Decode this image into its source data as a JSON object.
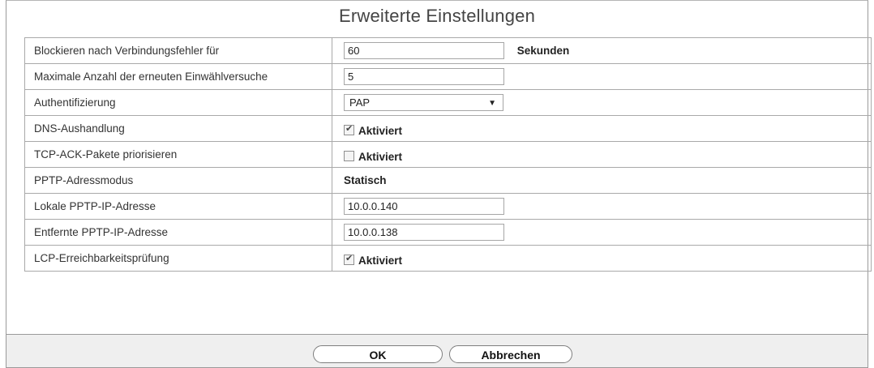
{
  "title": "Erweiterte Einstellungen",
  "rows": {
    "block": {
      "label": "Blockieren nach Verbindungsfehler für",
      "value": "60",
      "unit": "Sekunden"
    },
    "retries": {
      "label": "Maximale Anzahl der erneuten Einwählversuche",
      "value": "5"
    },
    "auth": {
      "label": "Authentifizierung",
      "selected": "PAP"
    },
    "dns": {
      "label": "DNS-Aushandlung",
      "checkbox_label": "Aktiviert",
      "checked": true
    },
    "tcpack": {
      "label": "TCP-ACK-Pakete priorisieren",
      "checkbox_label": "Aktiviert",
      "checked": false
    },
    "mode": {
      "label": "PPTP-Adressmodus",
      "value": "Statisch"
    },
    "local_ip": {
      "label": "Lokale PPTP-IP-Adresse",
      "value": "10.0.0.140"
    },
    "remote_ip": {
      "label": "Entfernte PPTP-IP-Adresse",
      "value": "10.0.0.138"
    },
    "lcp": {
      "label": "LCP-Erreichbarkeitsprüfung",
      "checkbox_label": "Aktiviert",
      "checked": true
    }
  },
  "buttons": {
    "ok": "OK",
    "cancel": "Abbrechen"
  }
}
